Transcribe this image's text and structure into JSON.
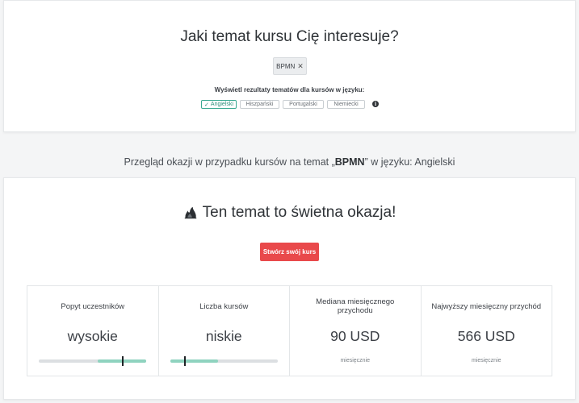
{
  "search": {
    "title": "Jaki temat kursu Cię interesuje?",
    "chip_label": "BPMN",
    "chip_remove": "✕",
    "language_label": "Wyświetl rezultaty tematów dla kursów w języku:",
    "languages": [
      {
        "label": "Angielski",
        "active": true,
        "check": "✓"
      },
      {
        "label": "Hiszpański",
        "active": false
      },
      {
        "label": "Portugalski",
        "active": false
      },
      {
        "label": "Niemiecki",
        "active": false
      }
    ],
    "info": "i"
  },
  "overview": {
    "prefix": "Przegląd okazji w przypadku kursów na temat „",
    "topic": "BPMN",
    "suffix": "” w języku: Angielski"
  },
  "result": {
    "title": "Ten temat to świetna okazja!",
    "icon": "fire-icon",
    "button_label": "Stwórz swój kurs",
    "stats": [
      {
        "label": "Popyt uczestników",
        "value": "wysokie",
        "gauge": {
          "level": 0.78,
          "fill_from": 0.55,
          "fill_to": 1.0
        }
      },
      {
        "label": "Liczba kursów",
        "value": "niskie",
        "gauge": {
          "level": 0.14,
          "fill_from": 0.0,
          "fill_to": 0.45
        }
      },
      {
        "label": "Mediana miesięcznego przychodu",
        "value": "90 USD",
        "sub": "miesięcznie"
      },
      {
        "label": "Najwyższy miesięczny przychód",
        "value": "566 USD",
        "sub": "miesięcznie"
      }
    ]
  },
  "colors": {
    "accent": "#3aa992",
    "button": "#e9494b",
    "gauge_fill": "#8fd3bf"
  }
}
